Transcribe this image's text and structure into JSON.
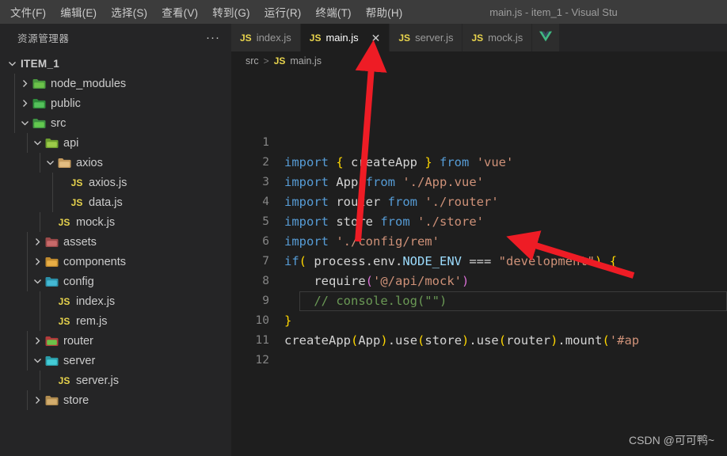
{
  "window": {
    "title": "main.js - item_1 - Visual Stu"
  },
  "menu": {
    "items": [
      {
        "label": "文件(F)",
        "name": "menu-file"
      },
      {
        "label": "编辑(E)",
        "name": "menu-edit"
      },
      {
        "label": "选择(S)",
        "name": "menu-selection"
      },
      {
        "label": "查看(V)",
        "name": "menu-view"
      },
      {
        "label": "转到(G)",
        "name": "menu-go"
      },
      {
        "label": "运行(R)",
        "name": "menu-run"
      },
      {
        "label": "终端(T)",
        "name": "menu-terminal"
      },
      {
        "label": "帮助(H)",
        "name": "menu-help"
      }
    ]
  },
  "sidebar": {
    "header": {
      "title": "资源管理器",
      "more_icon": "more-actions-icon"
    },
    "root": {
      "label": "ITEM_1",
      "expanded": true
    },
    "tree": [
      {
        "label": "node_modules",
        "type": "folder",
        "expanded": false,
        "depth": 1,
        "icon": "nodejs-folder-icon"
      },
      {
        "label": "public",
        "type": "folder",
        "expanded": false,
        "depth": 1,
        "icon": "public-folder-icon"
      },
      {
        "label": "src",
        "type": "folder",
        "expanded": true,
        "depth": 1,
        "icon": "src-folder-icon"
      },
      {
        "label": "api",
        "type": "folder",
        "expanded": true,
        "depth": 2,
        "icon": "api-folder-icon"
      },
      {
        "label": "axios",
        "type": "folder",
        "expanded": true,
        "depth": 3,
        "icon": "folder-icon"
      },
      {
        "label": "axios.js",
        "type": "file",
        "depth": 4,
        "icon": "js-file-icon"
      },
      {
        "label": "data.js",
        "type": "file",
        "depth": 4,
        "icon": "js-file-icon"
      },
      {
        "label": "mock.js",
        "type": "file",
        "depth": 3,
        "icon": "js-file-icon"
      },
      {
        "label": "assets",
        "type": "folder",
        "expanded": false,
        "depth": 2,
        "icon": "assets-folder-icon"
      },
      {
        "label": "components",
        "type": "folder",
        "expanded": false,
        "depth": 2,
        "icon": "components-folder-icon"
      },
      {
        "label": "config",
        "type": "folder",
        "expanded": true,
        "depth": 2,
        "icon": "config-folder-icon"
      },
      {
        "label": "index.js",
        "type": "file",
        "depth": 3,
        "icon": "js-file-icon"
      },
      {
        "label": "rem.js",
        "type": "file",
        "depth": 3,
        "icon": "js-file-icon"
      },
      {
        "label": "router",
        "type": "folder",
        "expanded": false,
        "depth": 2,
        "icon": "router-folder-icon"
      },
      {
        "label": "server",
        "type": "folder",
        "expanded": true,
        "depth": 2,
        "icon": "server-folder-icon"
      },
      {
        "label": "server.js",
        "type": "file",
        "depth": 3,
        "icon": "js-file-icon"
      },
      {
        "label": "store",
        "type": "folder",
        "expanded": false,
        "depth": 2,
        "icon": "store-folder-icon"
      }
    ]
  },
  "editor": {
    "tabs": [
      {
        "label": "index.js",
        "icon": "js-file-icon",
        "active": false,
        "closable": false
      },
      {
        "label": "main.js",
        "icon": "js-file-icon",
        "active": true,
        "closable": true,
        "close_icon": "close-icon"
      },
      {
        "label": "server.js",
        "icon": "js-file-icon",
        "active": false,
        "closable": false
      },
      {
        "label": "mock.js",
        "icon": "js-file-icon",
        "active": false,
        "closable": false
      },
      {
        "label": "",
        "icon": "vue-file-icon",
        "active": false,
        "closable": false
      }
    ],
    "breadcrumb": {
      "folder": "src",
      "separator": ">",
      "file": "main.js",
      "file_icon": "js-file-icon"
    },
    "line_numbers": [
      "1",
      "2",
      "3",
      "4",
      "5",
      "6",
      "7",
      "8",
      "9",
      "10",
      "11",
      "12"
    ],
    "lines": [
      {
        "n": "1",
        "tokens": []
      },
      {
        "n": "2",
        "tokens": [
          {
            "t": "import ",
            "c": "kw"
          },
          {
            "t": "{",
            "c": "br1"
          },
          {
            "t": " createApp ",
            "c": "plain"
          },
          {
            "t": "}",
            "c": "br1"
          },
          {
            "t": " ",
            "c": "plain"
          },
          {
            "t": "from",
            "c": "kw"
          },
          {
            "t": " ",
            "c": "plain"
          },
          {
            "t": "'vue'",
            "c": "str"
          }
        ]
      },
      {
        "n": "3",
        "tokens": [
          {
            "t": "import ",
            "c": "kw"
          },
          {
            "t": "App ",
            "c": "plain"
          },
          {
            "t": "from",
            "c": "kw"
          },
          {
            "t": " ",
            "c": "plain"
          },
          {
            "t": "'./App.vue'",
            "c": "str"
          }
        ]
      },
      {
        "n": "4",
        "tokens": [
          {
            "t": "import ",
            "c": "kw"
          },
          {
            "t": "router ",
            "c": "plain"
          },
          {
            "t": "from",
            "c": "kw"
          },
          {
            "t": " ",
            "c": "plain"
          },
          {
            "t": "'./router'",
            "c": "str"
          }
        ]
      },
      {
        "n": "5",
        "tokens": [
          {
            "t": "import ",
            "c": "kw"
          },
          {
            "t": "store ",
            "c": "plain"
          },
          {
            "t": "from",
            "c": "kw"
          },
          {
            "t": " ",
            "c": "plain"
          },
          {
            "t": "'./store'",
            "c": "str"
          }
        ]
      },
      {
        "n": "6",
        "tokens": [
          {
            "t": "import ",
            "c": "kw"
          },
          {
            "t": "'./config/rem'",
            "c": "str"
          }
        ]
      },
      {
        "n": "7",
        "tokens": [
          {
            "t": "if",
            "c": "kw"
          },
          {
            "t": "(",
            "c": "br1"
          },
          {
            "t": " process",
            "c": "plain"
          },
          {
            "t": ".env.",
            "c": "plain"
          },
          {
            "t": "NODE_ENV",
            "c": "var"
          },
          {
            "t": " === ",
            "c": "plain"
          },
          {
            "t": "\"development\"",
            "c": "str"
          },
          {
            "t": ")",
            "c": "br1"
          },
          {
            "t": " ",
            "c": "plain"
          },
          {
            "t": "{",
            "c": "br1"
          }
        ]
      },
      {
        "n": "8",
        "tokens": [
          {
            "t": "    ",
            "c": "plain"
          },
          {
            "t": "require",
            "c": "plain"
          },
          {
            "t": "(",
            "c": "br2"
          },
          {
            "t": "'@/api/mock'",
            "c": "str"
          },
          {
            "t": ")",
            "c": "br2"
          }
        ]
      },
      {
        "n": "9",
        "tokens": [
          {
            "t": "    // console.log(\"\")",
            "c": "com"
          }
        ]
      },
      {
        "n": "10",
        "tokens": [
          {
            "t": "}",
            "c": "br1"
          }
        ]
      },
      {
        "n": "11",
        "tokens": [
          {
            "t": "createApp",
            "c": "plain"
          },
          {
            "t": "(",
            "c": "br1"
          },
          {
            "t": "App",
            "c": "plain"
          },
          {
            "t": ")",
            "c": "br1"
          },
          {
            "t": ".",
            "c": "plain"
          },
          {
            "t": "use",
            "c": "plain"
          },
          {
            "t": "(",
            "c": "br1"
          },
          {
            "t": "store",
            "c": "plain"
          },
          {
            "t": ")",
            "c": "br1"
          },
          {
            "t": ".",
            "c": "plain"
          },
          {
            "t": "use",
            "c": "plain"
          },
          {
            "t": "(",
            "c": "br1"
          },
          {
            "t": "router",
            "c": "plain"
          },
          {
            "t": ")",
            "c": "br1"
          },
          {
            "t": ".",
            "c": "plain"
          },
          {
            "t": "mount",
            "c": "plain"
          },
          {
            "t": "(",
            "c": "br1"
          },
          {
            "t": "'#ap",
            "c": "str"
          }
        ]
      },
      {
        "n": "12",
        "tokens": []
      }
    ],
    "code_plain": [
      "",
      "import { createApp } from 'vue'",
      "import App from './App.vue'",
      "import router from './router'",
      "import store from './store'",
      "import './config/rem'",
      "if( process.env.NODE_ENV === \"development\") {",
      "    require('@/api/mock')",
      "    // console.log(\"\")",
      "}",
      "createApp(App).use(store).use(router).mount('#ap",
      ""
    ]
  },
  "annotations": {
    "arrows": [
      {
        "name": "arrow-to-main-tab",
        "color": "#ee1c25"
      },
      {
        "name": "arrow-to-console-log",
        "color": "#ee1c25"
      }
    ]
  },
  "watermark": {
    "text": "CSDN @可可鸭~"
  },
  "colors": {
    "editor_bg": "#1e1e1e",
    "sidebar_bg": "#252526",
    "titlebar_bg": "#3c3c3c",
    "tab_inactive_bg": "#2d2d2d",
    "accent_js": "#e8d44d",
    "arrow_red": "#ee1c25",
    "keyword_blue": "#569cd6",
    "string_orange": "#ce9178",
    "comment_green": "#6a9955",
    "bracket_yellow": "#ffd700",
    "bracket_magenta": "#da70d6"
  }
}
